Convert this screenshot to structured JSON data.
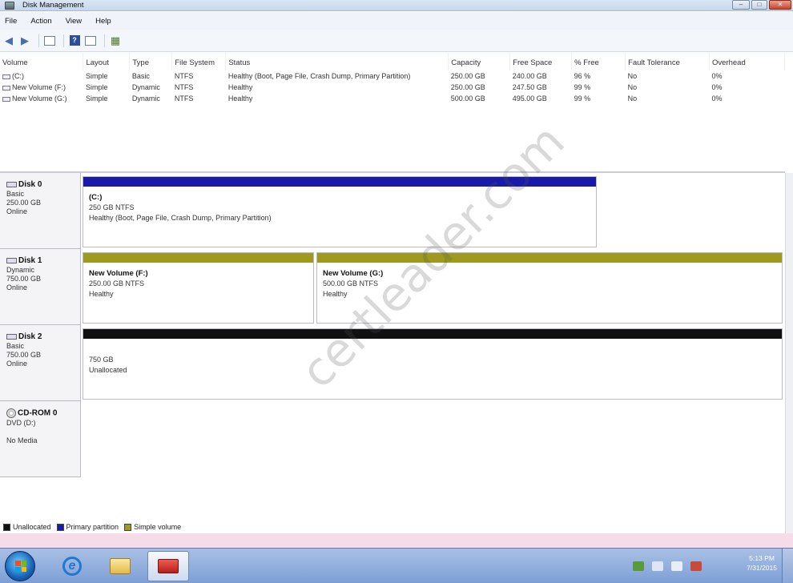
{
  "window": {
    "title": "Disk Management"
  },
  "menu": [
    "File",
    "Action",
    "View",
    "Help"
  ],
  "volume_table": {
    "columns": [
      "Volume",
      "Layout",
      "Type",
      "File System",
      "Status",
      "Capacity",
      "Free Space",
      "% Free",
      "Fault Tolerance",
      "Overhead"
    ],
    "rows": [
      [
        "(C:)",
        "Simple",
        "Basic",
        "NTFS",
        "Healthy (Boot, Page File, Crash Dump, Primary Partition)",
        "250.00 GB",
        "240.00 GB",
        "96 %",
        "No",
        "0%"
      ],
      [
        "New Volume (F:)",
        "Simple",
        "Dynamic",
        "NTFS",
        "Healthy",
        "250.00 GB",
        "247.50 GB",
        "99 %",
        "No",
        "0%"
      ],
      [
        "New Volume (G:)",
        "Simple",
        "Dynamic",
        "NTFS",
        "Healthy",
        "500.00 GB",
        "495.00 GB",
        "99 %",
        "No",
        "0%"
      ]
    ]
  },
  "disks": [
    {
      "name": "Disk 0",
      "type": "Basic",
      "size": "250.00 GB",
      "status": "Online",
      "partitions": [
        {
          "title": "(C:)",
          "line1": "250 GB NTFS",
          "line2": "Healthy (Boot, Page File, Crash Dump, Primary Partition)"
        }
      ]
    },
    {
      "name": "Disk 1",
      "type": "Dynamic",
      "size": "750.00 GB",
      "status": "Online",
      "partitions": [
        {
          "title": "New Volume (F:)",
          "line1": "250.00 GB NTFS",
          "line2": "Healthy"
        },
        {
          "title": "New Volume (G:)",
          "line1": "500.00 GB NTFS",
          "line2": "Healthy"
        }
      ]
    },
    {
      "name": "Disk 2",
      "type": "Basic",
      "size": "750.00 GB",
      "status": "Online",
      "partitions": [
        {
          "title": "",
          "line1": "750 GB",
          "line2": "Unallocated"
        }
      ]
    },
    {
      "name": "CD-ROM 0",
      "type": "DVD (D:)",
      "size": "",
      "status": "No Media",
      "partitions": []
    }
  ],
  "legend": [
    {
      "label": "Unallocated",
      "color": "#111111"
    },
    {
      "label": "Primary partition",
      "color": "#1a1aa8"
    },
    {
      "label": "Simple volume",
      "color": "#9e9a1f"
    }
  ],
  "colors": {
    "primary": "#1a1aa8",
    "simple": "#9e9a1f",
    "unallocated": "#111111"
  },
  "clock": {
    "time": "5:13 PM",
    "date": "7/31/2015"
  },
  "watermark": "certleader.com"
}
